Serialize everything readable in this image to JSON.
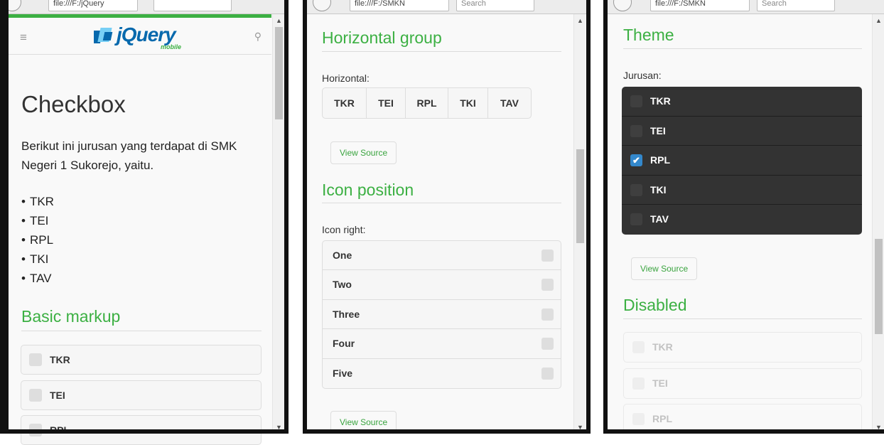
{
  "panel1": {
    "url": "file:///F:/jQuery",
    "brand_word": "jQuery",
    "brand_sub": "mobile",
    "page_title": "Checkbox",
    "intro": "Berikut ini jurusan yang terdapat di SMK Negeri 1 Sukorejo, yaitu.",
    "bullets": [
      "TKR",
      "TEI",
      "RPL",
      "TKI",
      "TAV"
    ],
    "section_title": "Basic markup",
    "checkboxes": [
      "TKR",
      "TEI",
      "RPL"
    ]
  },
  "panel2": {
    "url": "file:///F:/SMKN",
    "search_placeholder": "Search",
    "horizontal_title": "Horizontal group",
    "horizontal_label": "Horizontal:",
    "horizontal_items": [
      "TKR",
      "TEI",
      "RPL",
      "TKI",
      "TAV"
    ],
    "view_source": "View Source",
    "icon_title": "Icon position",
    "icon_label": "Icon right:",
    "icon_items": [
      "One",
      "Two",
      "Three",
      "Four",
      "Five"
    ],
    "view_source_2": "View Source"
  },
  "panel3": {
    "url": "file:///F:/SMKN",
    "search_placeholder": "Search",
    "theme_title": "Theme",
    "theme_label": "Jurusan:",
    "theme_items": [
      "TKR",
      "TEI",
      "RPL",
      "TKI",
      "TAV"
    ],
    "theme_checked": "RPL",
    "view_source": "View Source",
    "disabled_title": "Disabled",
    "disabled_items": [
      "TKR",
      "TEI",
      "RPL"
    ]
  },
  "icons": {
    "hamburger": "menu-icon",
    "search": "search-icon",
    "check": "checkmark-icon",
    "scroll_up": "scroll-up-arrow-icon",
    "scroll_down": "scroll-down-arrow-icon"
  },
  "colors": {
    "accent_green": "#3cb043",
    "jquery_blue": "#0769ad",
    "checked_blue": "#3388cc",
    "dark_theme": "#333333"
  }
}
